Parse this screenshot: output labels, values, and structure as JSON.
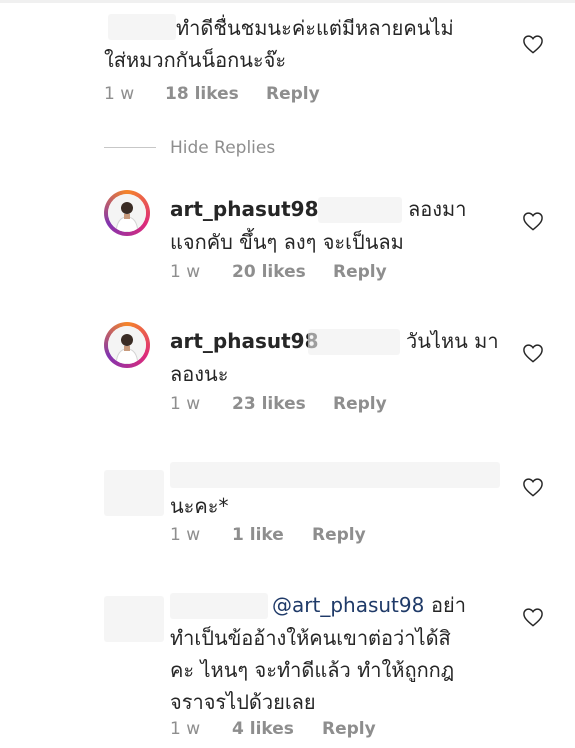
{
  "comments": [
    {
      "text_line1": "ทำดีชื่นชมนะค่ะแต่มีหลายคนไม่",
      "text_line2": "ใส่หมวกกันน็อกนะจ๊ะ",
      "time": "1 w",
      "likes": "18 likes",
      "reply": "Reply"
    },
    {
      "username": "art_phasut98",
      "text_tail": "ลองมา",
      "text_line2": "แจกคับ ขึ้นๆ ลงๆ จะเป็นลม",
      "time": "1 w",
      "likes": "20 likes",
      "reply": "Reply"
    },
    {
      "username": "art_phasut98",
      "text_tail": "วันไหน มา",
      "text_line2": "ลองนะ",
      "time": "1 w",
      "likes": "23 likes",
      "reply": "Reply"
    },
    {
      "text_line1": "นะคะ*",
      "time": "1 w",
      "likes": "1 like",
      "reply": "Reply"
    },
    {
      "mention": "@art_phasut98",
      "text_tail": "อย่า",
      "text_line2": "ทำเป็นข้ออ้างให้คนเขาต่อว่าได้สิ",
      "text_line3": "คะ ไหนๆ จะทำดีแล้ว ทำให้ถูกกฎ",
      "text_line4": "จราจรไปด้วยเลย",
      "time": "1 w",
      "likes": "4 likes",
      "reply": "Reply"
    }
  ],
  "hide_replies": "Hide Replies",
  "icons": {
    "like": "heart-outline-icon",
    "avatar": "profile-photo"
  },
  "colors": {
    "text": "#262626",
    "meta": "#8e8e8e",
    "mention": "#1f3a68",
    "avatar_ring": "#dd2a7b"
  }
}
